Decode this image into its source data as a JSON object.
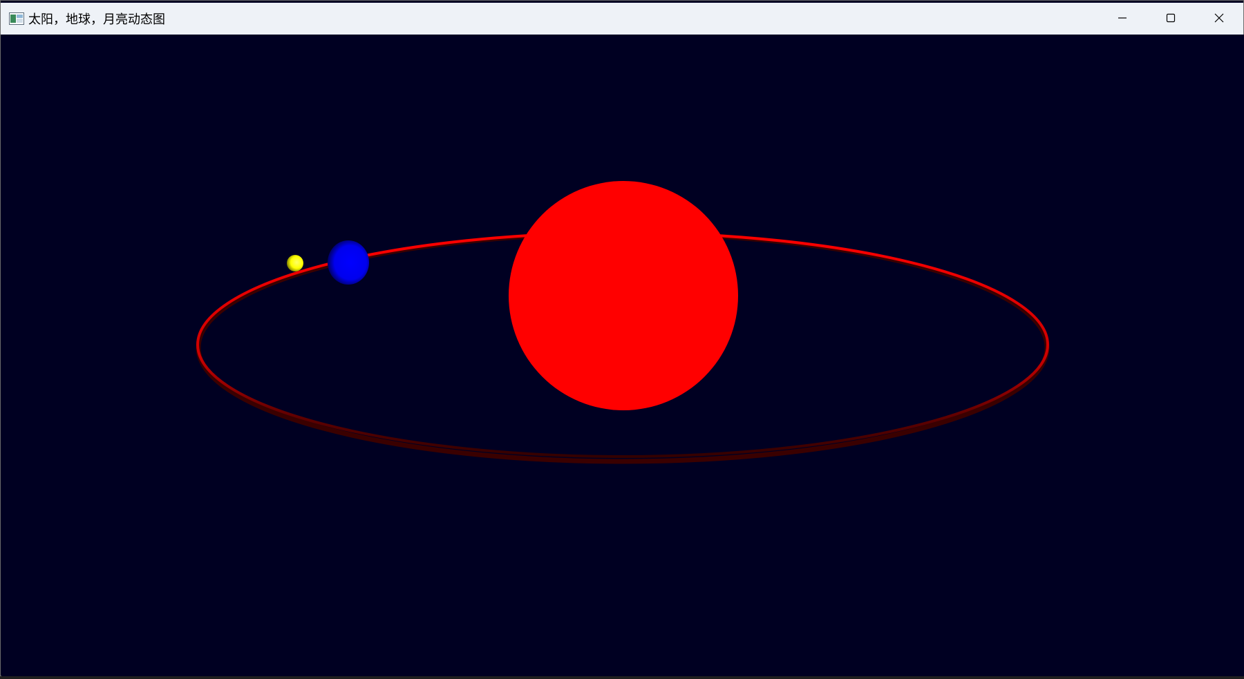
{
  "window": {
    "title": "太阳，地球，月亮动态图",
    "icon": "app-window-icon",
    "controls": {
      "minimize": "minimize-icon",
      "maximize": "maximize-icon",
      "close": "close-icon"
    }
  },
  "scene": {
    "background_color": "#000022",
    "sun_color": "#ff0000",
    "orbit_color": "#ff0000",
    "earth_color": "#0000ff",
    "moon_color": "#ffff00"
  }
}
